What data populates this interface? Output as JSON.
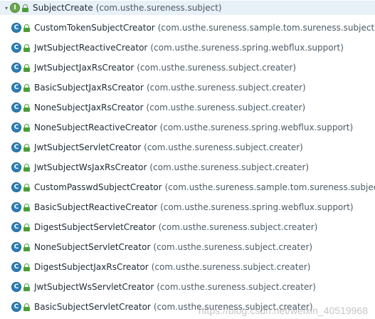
{
  "root": {
    "name": "SubjectCreate",
    "package": "(com.usthe.sureness.subject)",
    "icon": "interface-icon"
  },
  "items": [
    {
      "name": "CustomTokenSubjectCreator",
      "package": "(com.usthe.sureness.sample.tom.sureness.subject)"
    },
    {
      "name": "JwtSubjectReactiveCreator",
      "package": "(com.usthe.sureness.spring.webflux.support)"
    },
    {
      "name": "JwtSubjectJaxRsCreator",
      "package": "(com.usthe.sureness.subject.creater)"
    },
    {
      "name": "BasicSubjectJaxRsCreator",
      "package": "(com.usthe.sureness.subject.creater)"
    },
    {
      "name": "NoneSubjectJaxRsCreator",
      "package": "(com.usthe.sureness.subject.creater)"
    },
    {
      "name": "NoneSubjectReactiveCreator",
      "package": "(com.usthe.sureness.spring.webflux.support)"
    },
    {
      "name": "JwtSubjectServletCreator",
      "package": "(com.usthe.sureness.subject.creater)"
    },
    {
      "name": "JwtSubjectWsJaxRsCreator",
      "package": "(com.usthe.sureness.subject.creater)"
    },
    {
      "name": "CustomPasswdSubjectCreator",
      "package": "(com.usthe.sureness.sample.tom.sureness.subject)"
    },
    {
      "name": "BasicSubjectReactiveCreator",
      "package": "(com.usthe.sureness.spring.webflux.support)"
    },
    {
      "name": "DigestSubjectServletCreator",
      "package": "(com.usthe.sureness.subject.creater)"
    },
    {
      "name": "NoneSubjectServletCreator",
      "package": "(com.usthe.sureness.subject.creater)"
    },
    {
      "name": "DigestSubjectJaxRsCreator",
      "package": "(com.usthe.sureness.subject.creater)"
    },
    {
      "name": "JwtSubjectWsServletCreator",
      "package": "(com.usthe.sureness.subject.creater)"
    },
    {
      "name": "BasicSubjectServletCreator",
      "package": "(com.usthe.sureness.subject.creater)"
    }
  ],
  "icons": {
    "class_letter": "C",
    "interface_letter": "I",
    "expander_glyph": "▾"
  },
  "watermark": "https://blog.csdn.net/weixin_40519968"
}
